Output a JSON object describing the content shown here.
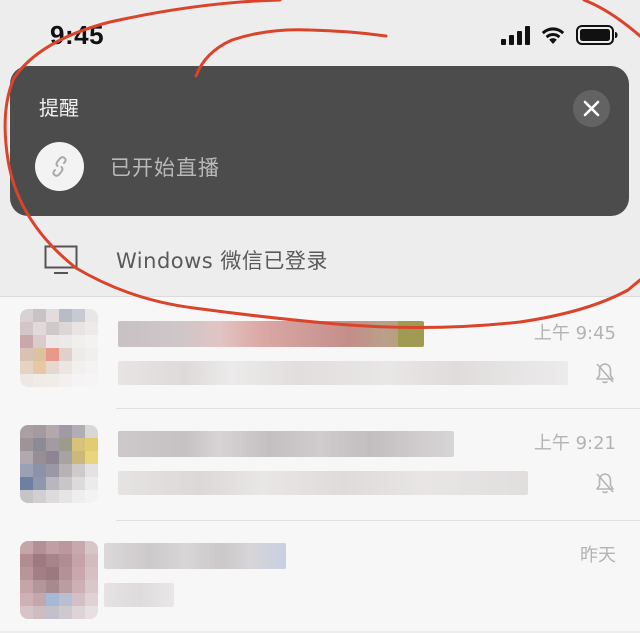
{
  "status_bar": {
    "time": "9:45",
    "icons": [
      "signal-icon",
      "wifi-icon",
      "battery-icon"
    ]
  },
  "notification": {
    "title": "提醒",
    "message": "已开始直播",
    "icon": "mini-program-link-icon",
    "close_icon": "close-icon"
  },
  "desktop_login": {
    "text": "Windows 微信已登录",
    "icon": "monitor-icon"
  },
  "chats": [
    {
      "time": "上午 9:45",
      "muted": true
    },
    {
      "time": "上午 9:21",
      "muted": true
    },
    {
      "time": "昨天",
      "muted": false
    }
  ],
  "colors": {
    "notification_bg": "#4c4c4c",
    "page_bg": "#ededed",
    "list_bg": "#f7f7f7",
    "annotation_red": "#d9442b"
  }
}
